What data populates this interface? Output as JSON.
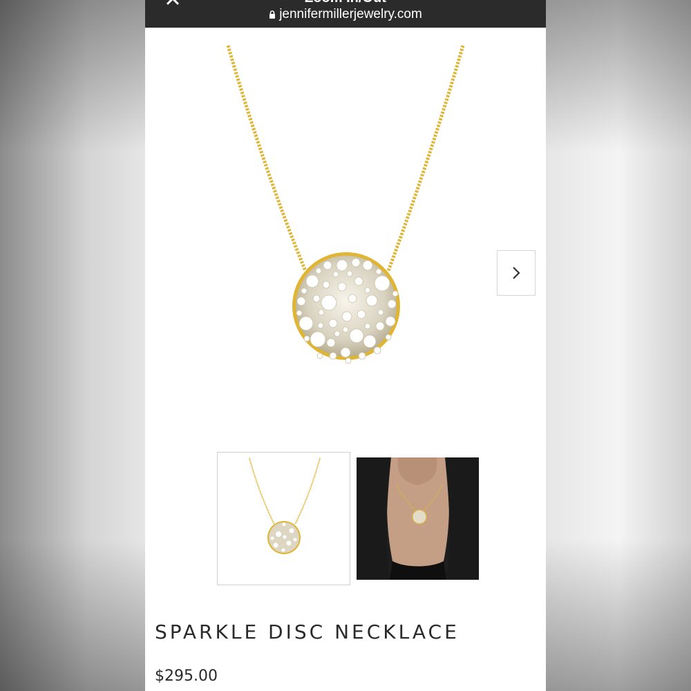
{
  "browser": {
    "title": "Zoom In/Out",
    "url": "jennifermillerjewelry.com",
    "close_icon": "close-icon",
    "lock_icon": "lock-icon"
  },
  "gallery": {
    "next_icon": "chevron-right-icon",
    "thumbnails": [
      "product-only",
      "worn-on-model"
    ]
  },
  "product": {
    "title": "SPARKLE DISC NECKLACE",
    "price": "$295.00"
  },
  "colors": {
    "gold": "#e0b534",
    "topbar": "#2b2b2b",
    "text": "#2a2a2a"
  }
}
